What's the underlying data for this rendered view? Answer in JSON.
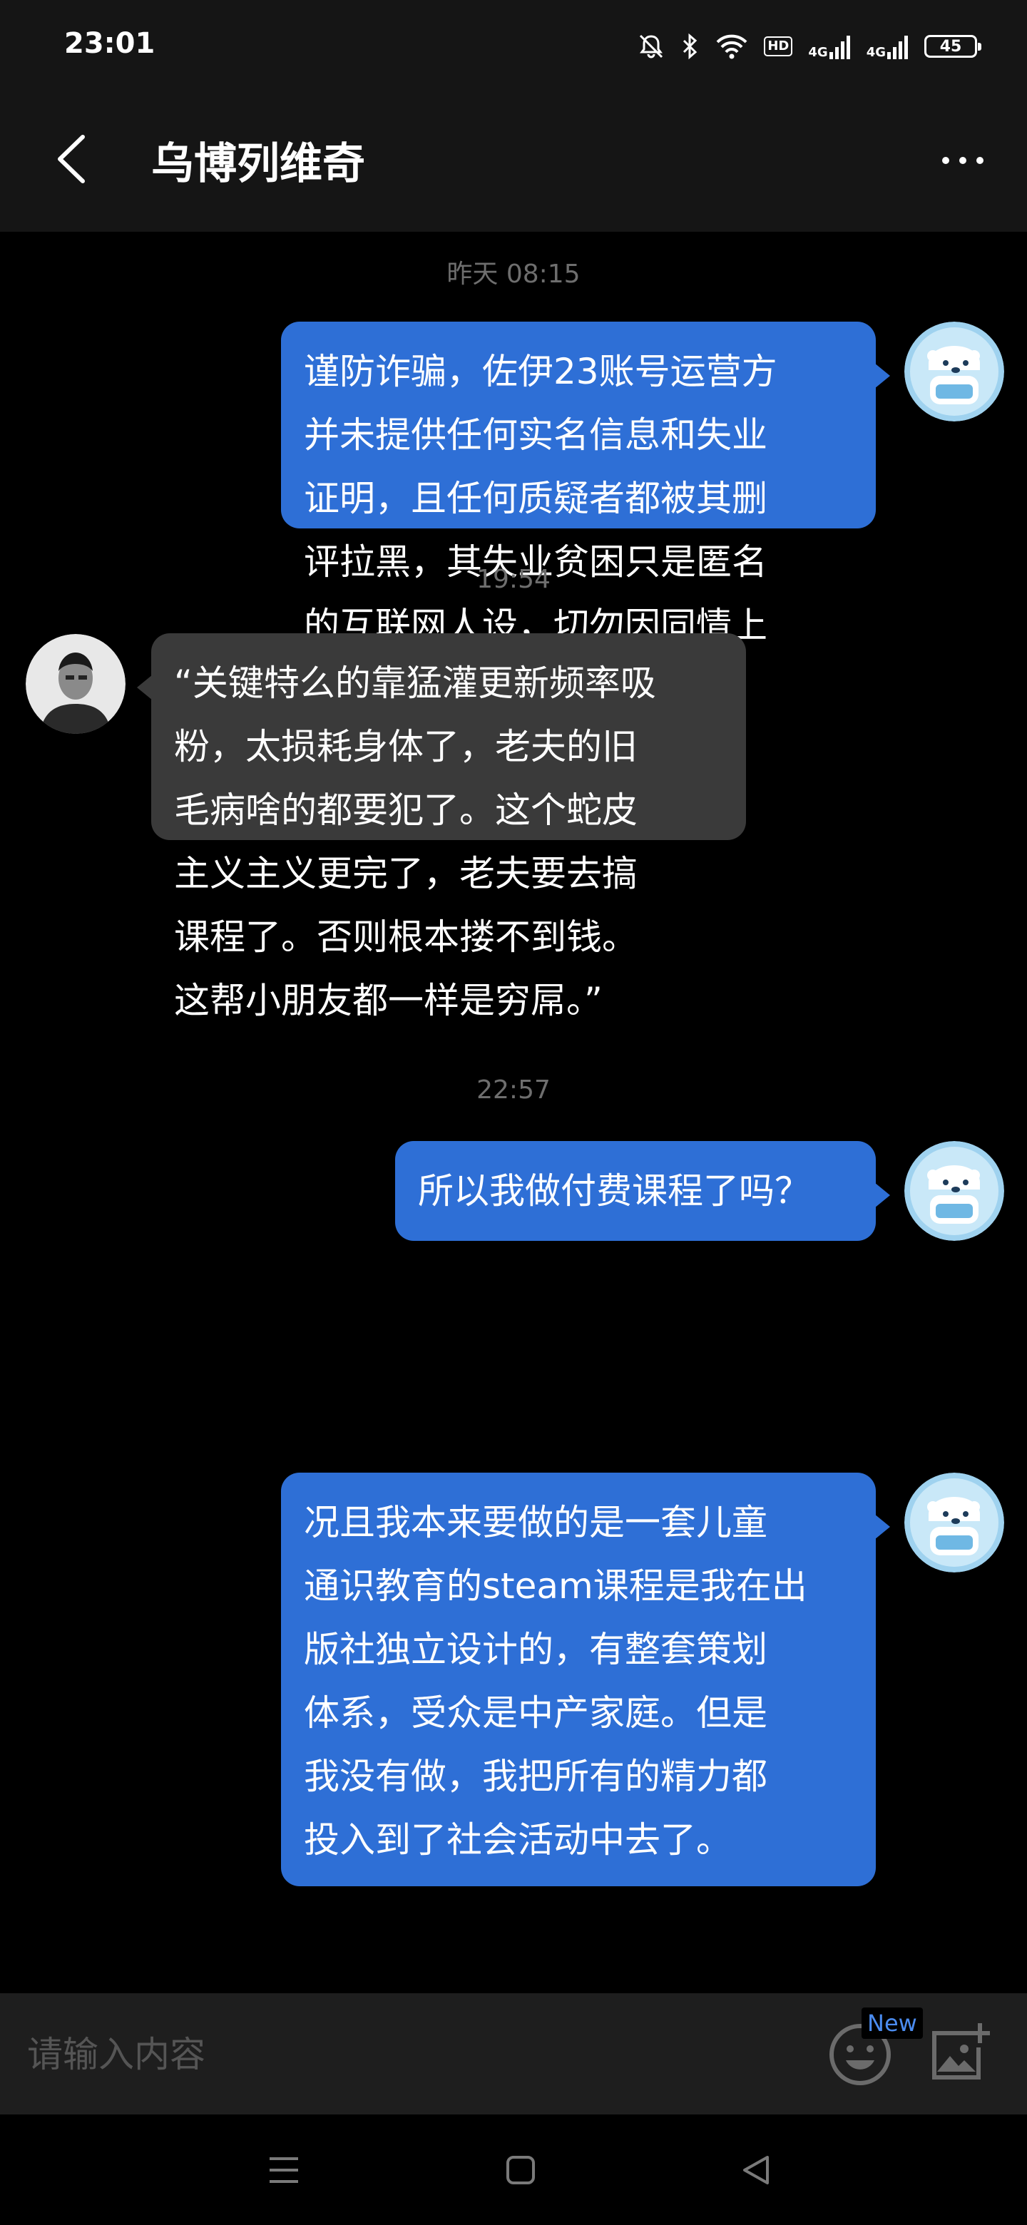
{
  "status_bar": {
    "time": "23:01",
    "hd_label": "HD",
    "signal1_label": "4G",
    "signal2_label": "4G",
    "battery": "45",
    "icons": [
      "mute-icon",
      "bluetooth-icon",
      "wifi-icon",
      "hd-icon",
      "signal-icon",
      "signal-icon",
      "battery-icon"
    ]
  },
  "header": {
    "title": "乌博列维奇",
    "back_icon": "back-arrow-icon",
    "more_icon": "more-icon"
  },
  "messages": [
    {
      "type": "timestamp",
      "text": "昨天 08:15"
    },
    {
      "type": "message",
      "sender": "me",
      "avatar": "polar-bear-avatar",
      "text": "谨防诈骗，佐伊23账号运营方\n并未提供任何实名信息和失业\n证明，且任何质疑者都被其删\n评拉黑，其失业贫困只是匿名\n的互联网人设，切勿因同情上\n当。"
    },
    {
      "type": "timestamp",
      "text": "19:54"
    },
    {
      "type": "message",
      "sender": "other",
      "avatar": "portrait-avatar",
      "text": "“关键特么的靠猛灌更新频率吸\n粉，太损耗身体了，老夫的旧\n毛病啥的都要犯了。这个蛇皮\n主义主义更完了，老夫要去搞\n课程了。否则根本搂不到钱。\n这帮小朋友都一样是穷屌。”"
    },
    {
      "type": "timestamp",
      "text": "22:57"
    },
    {
      "type": "message",
      "sender": "me",
      "avatar": "polar-bear-avatar",
      "text": "所以我做付费课程了吗？"
    },
    {
      "type": "message",
      "sender": "me",
      "avatar": "polar-bear-avatar",
      "text": "况且我本来要做的是一套儿童\n通识教育的steam课程是我在出\n版社独立设计的，有整套策划\n体系，受众是中产家庭。但是\n我没有做，我把所有的精力都\n投入到了社会活动中去了。"
    }
  ],
  "input": {
    "placeholder": "请输入内容",
    "value": "",
    "new_badge": "New",
    "emoji_icon": "emoji-icon",
    "image_icon": "add-image-icon"
  },
  "nav": {
    "icons": [
      "menu-icon",
      "home-square-icon",
      "back-triangle-icon"
    ]
  },
  "colors": {
    "my_bubble": "#2e6fd6",
    "other_bubble": "#3a3a3a",
    "header_bg": "#151515",
    "chat_bg": "#000000"
  }
}
